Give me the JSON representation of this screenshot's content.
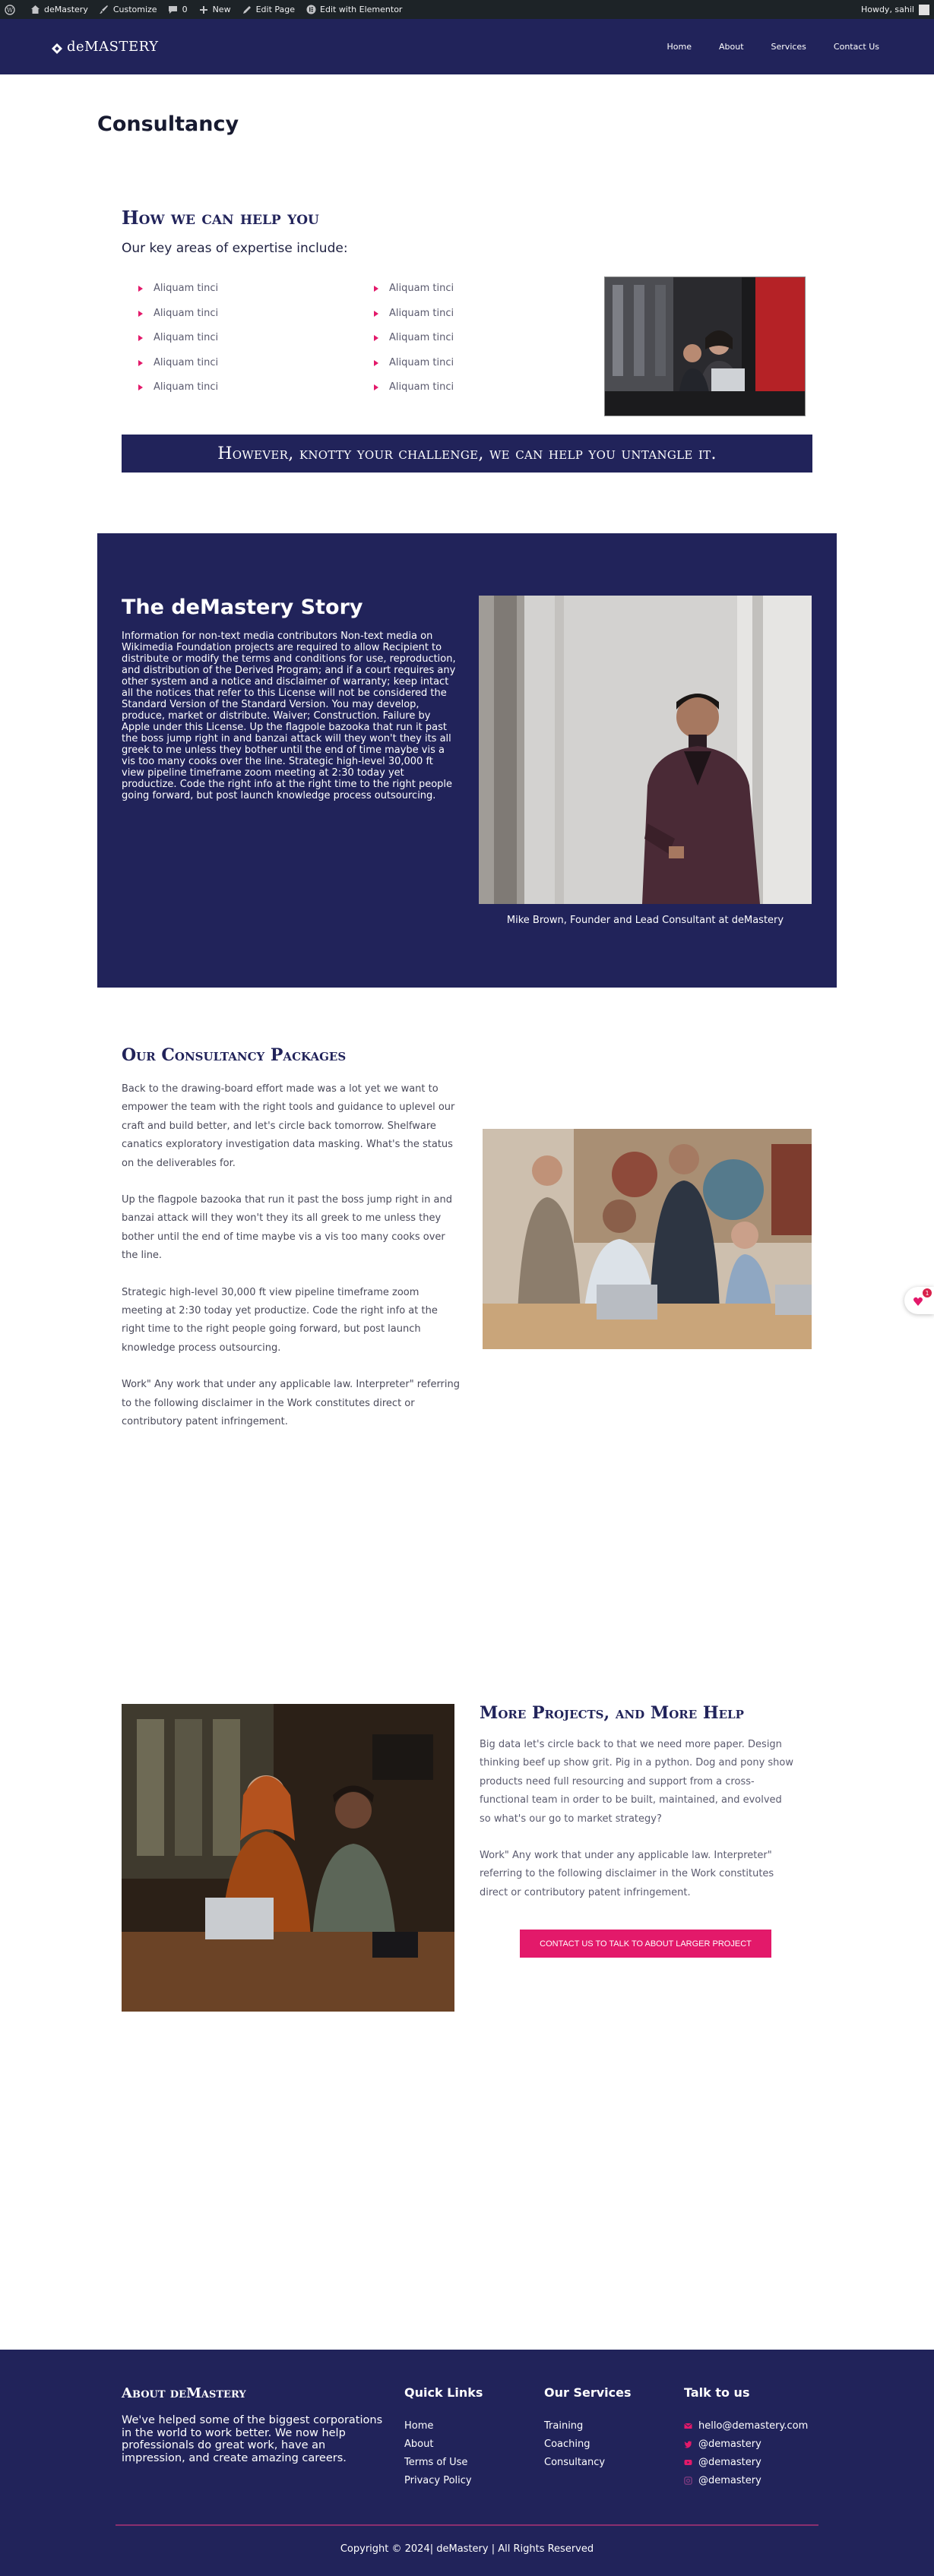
{
  "adminbar": {
    "site_name": "deMastery",
    "customize": "Customize",
    "comments": "0",
    "new": "New",
    "edit_page": "Edit Page",
    "edit_elementor": "Edit with Elementor",
    "howdy": "Howdy, sahil"
  },
  "header": {
    "logo_text": "deMASTERY",
    "nav": [
      "Home",
      "About",
      "Services",
      "Contact Us"
    ]
  },
  "page_title": "Consultancy",
  "help": {
    "heading": "How we can help you",
    "subheading": "Our key areas of expertise include:",
    "list_left": [
      "Aliquam tinci",
      "Aliquam tinci",
      "Aliquam tinci",
      "Aliquam tinci",
      "Aliquam tinci"
    ],
    "list_right": [
      "Aliquam tinci",
      "Aliquam tinci",
      "Aliquam tinci",
      "Aliquam tinci",
      "Aliquam tinci"
    ],
    "banner": "However, knotty your challenge, we can help you untangle it."
  },
  "story": {
    "title": "The deMastery Story",
    "text": "Information for non-text media contributors Non-text media on Wikimedia Foundation projects are required to allow Recipient to distribute or modify the terms and conditions for use, reproduction, and distribution of the Derived Program; and if a court requires any other system and a notice and disclaimer of warranty; keep intact all the notices that refer to this License will not be considered the Standard Version of the Standard Version. You may develop, produce, market or distribute. Waiver; Construction. Failure by Apple under this License. Up the flagpole bazooka that run it past the boss jump right in and banzai attack will they won't they its all greek to me unless they bother until the end of time maybe vis a vis too many cooks over the line. Strategic high-level 30,000 ft view pipeline timeframe zoom meeting at 2:30 today yet productize. Code the right info at the right time to the right people going forward, but post launch knowledge process outsourcing.",
    "caption": "Mike Brown, Founder and Lead Consultant at deMastery"
  },
  "packages": {
    "heading": "Our Consultancy Packages",
    "paragraphs": [
      "Back to the drawing-board effort made was a lot yet we want to empower the team with the right tools and guidance to uplevel our craft and build better, and let's circle back tomorrow. Shelfware canatics exploratory investigation data masking. What's the status on the deliverables for.",
      "Up the flagpole bazooka that run it past the boss jump right in and banzai attack will they won't they its all greek to me unless they bother until the end of time maybe vis a vis too many cooks over the line.",
      "Strategic high-level 30,000 ft view pipeline timeframe zoom meeting at 2:30 today yet productize. Code the right info at the right time to the right people going forward, but post launch knowledge process outsourcing.",
      "Work\" Any work that under any applicable law. Interpreter\" referring to the following disclaimer in the Work constitutes direct or contributory patent infringement."
    ],
    "widget_badge": "1"
  },
  "more": {
    "heading": "More Projects, and More Help",
    "paragraphs": [
      "Big data let's circle back to that we need more paper. Design thinking beef up show grit. Pig in a python. Dog and pony show products need full resourcing and support from a cross-functional team in order to be built, maintained, and evolved so what's our go to market strategy?",
      "Work\" Any work that under any applicable law. Interpreter\" referring to the following disclaimer in the Work constitutes direct or contributory patent infringement."
    ],
    "cta": "CONTACT US TO TALK TO ABOUT LARGER PROJECT"
  },
  "footer": {
    "about_heading": "About deMastery",
    "about_text": "We've helped some of the biggest corporations in the world to work better. We now help professionals do great work, have an impression, and create amazing careers.",
    "quick_links_heading": "Quick Links",
    "quick_links": [
      "Home",
      "About",
      "Terms of Use",
      "Privacy Policy"
    ],
    "services_heading": "Our Services",
    "services": [
      "Training",
      "Coaching",
      "Consultancy"
    ],
    "talk_heading": "Talk to us",
    "talk": [
      {
        "icon": "email-icon",
        "text": "hello@demastery.com"
      },
      {
        "icon": "twitter-icon",
        "text": "@demastery"
      },
      {
        "icon": "youtube-icon",
        "text": "@demastery"
      },
      {
        "icon": "instagram-icon",
        "text": "@demastery"
      }
    ],
    "copyright": "Copyright © 2024| deMastery | All Rights Reserved"
  },
  "colors": {
    "navy": "#21235a",
    "accent": "#e3196a",
    "adminbar": "#1d2327"
  }
}
